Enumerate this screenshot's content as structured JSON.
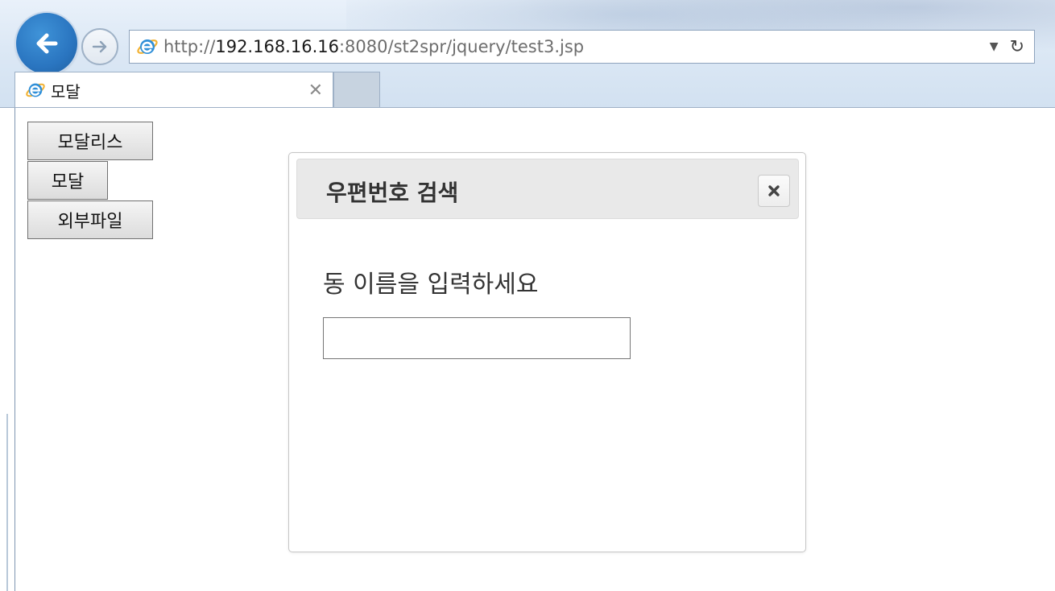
{
  "browser": {
    "address_bar": {
      "url_scheme": "http://",
      "url_host": "192.168.16.16",
      "url_rest": ":8080/st2spr/jquery/test3.jsp",
      "dropdown_glyph": "▼",
      "refresh_glyph": "↻"
    },
    "tab": {
      "title": "모달",
      "close_glyph": "✕"
    },
    "icons": {
      "back": "back-arrow-icon",
      "forward": "forward-arrow-icon",
      "site": "ie-logo-icon"
    },
    "colors": {
      "back_button": "#2a75c0",
      "chrome_bg": "#dce8f5"
    }
  },
  "page": {
    "buttons": {
      "modeless": "모달리스",
      "modal": "모달",
      "external_file": "외부파일"
    }
  },
  "dialog": {
    "title": "우편번호 검색",
    "close_icon": "close-x-icon",
    "label": "동 이름을 입력하세요",
    "input_value": "",
    "colors": {
      "header_bg": "#e9e9e9",
      "title_text": "#333333"
    }
  }
}
